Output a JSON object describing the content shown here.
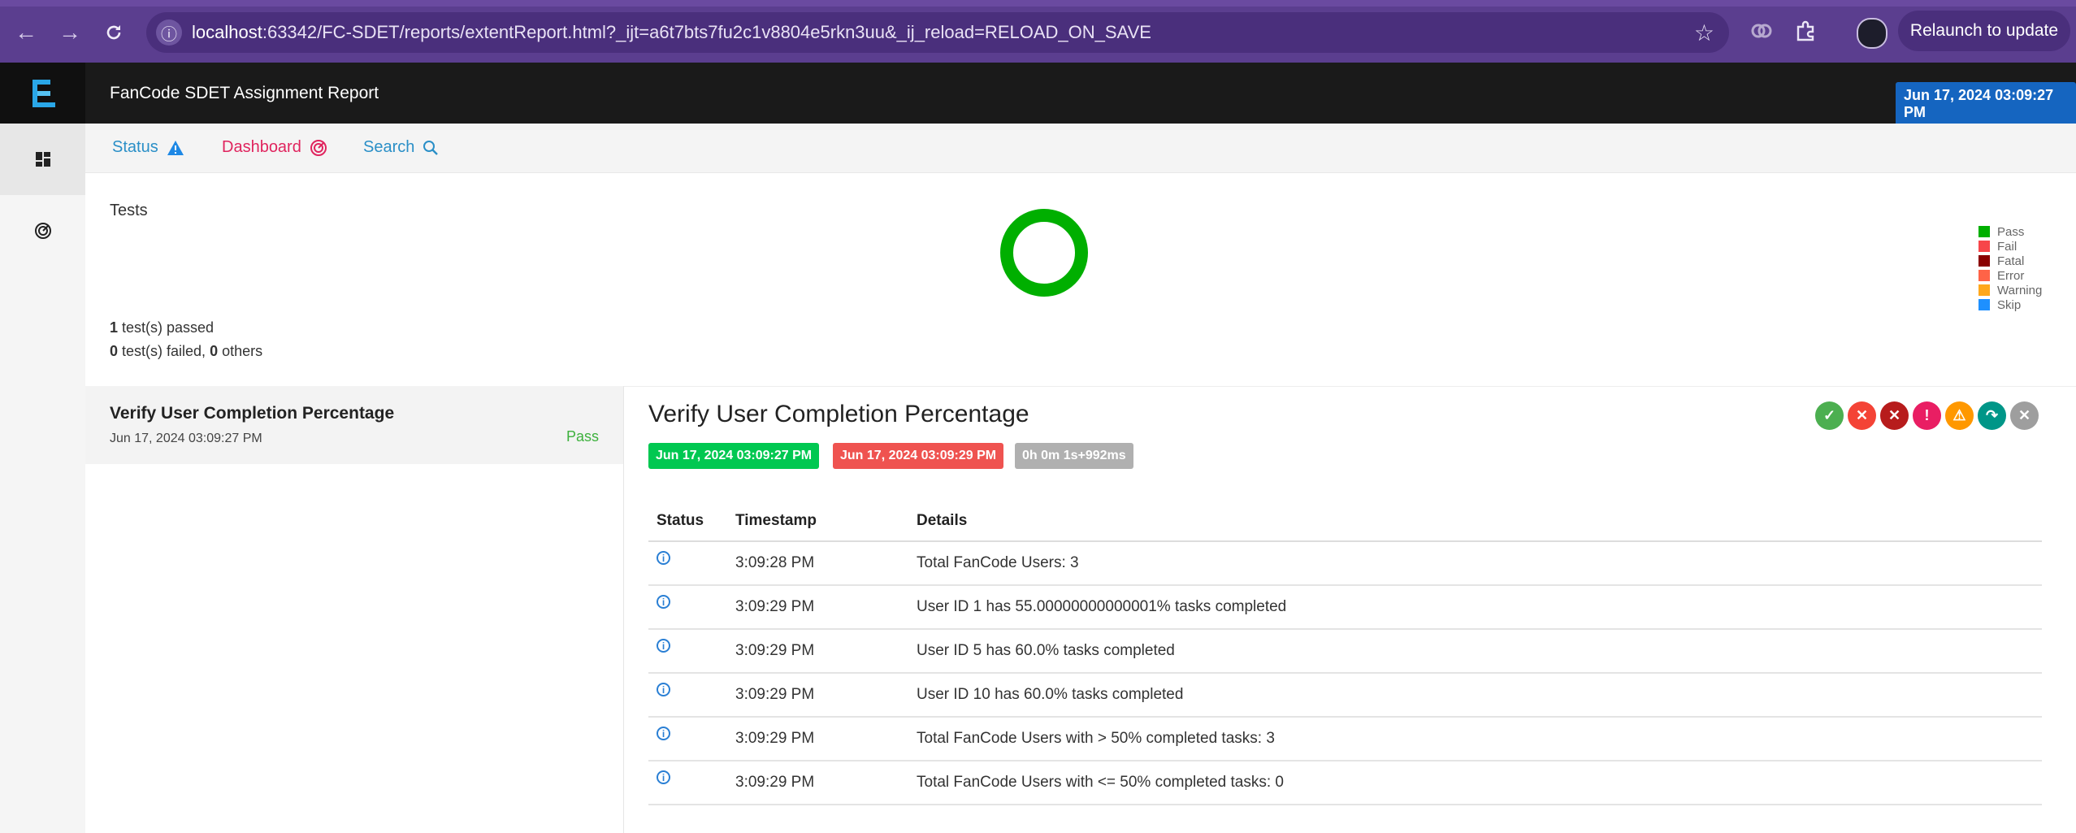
{
  "browser": {
    "url_host": "localhost",
    "url_rest": ":63342/FC-SDET/reports/extentReport.html?_ijt=a6t7bts7fu2c1v8804e5rkn3uu&_ij_reload=RELOAD_ON_SAVE",
    "relaunch_label": "Relaunch to update",
    "icons": [
      "back-icon",
      "forward-icon",
      "reload-icon",
      "site-info-icon",
      "star-icon",
      "extension-icon",
      "puzzle-icon",
      "profile-icon"
    ]
  },
  "header": {
    "title": "FanCode SDET Assignment Report",
    "datetime": "Jun 17, 2024 03:09:27 PM"
  },
  "subnav": {
    "status": "Status",
    "dashboard": "Dashboard",
    "search": "Search"
  },
  "summary": {
    "title": "Tests",
    "passed_count": "1",
    "passed_text": " test(s) passed",
    "failed_count": "0",
    "failed_text": " test(s) failed, ",
    "others_count": "0",
    "others_text": " others",
    "legend": [
      {
        "label": "Pass",
        "color": "#00af00"
      },
      {
        "label": "Fail",
        "color": "#f7464a"
      },
      {
        "label": "Fatal",
        "color": "#8b0000"
      },
      {
        "label": "Error",
        "color": "#ff6347"
      },
      {
        "label": "Warning",
        "color": "#ffa81c"
      },
      {
        "label": "Skip",
        "color": "#1e90ff"
      }
    ],
    "pass_fraction": 1.0
  },
  "test_list": [
    {
      "name": "Verify User Completion Percentage",
      "time": "Jun 17, 2024 03:09:27 PM",
      "status": "Pass"
    }
  ],
  "detail": {
    "title": "Verify User Completion Percentage",
    "start": "Jun 17, 2024 03:09:27 PM",
    "end": "Jun 17, 2024 03:09:29 PM",
    "duration": "0h 0m 1s+992ms",
    "columns": [
      "Status",
      "Timestamp",
      "Details"
    ],
    "logs": [
      {
        "time": "3:09:28 PM",
        "details": "Total FanCode Users: 3"
      },
      {
        "time": "3:09:29 PM",
        "details": "User ID 1 has 55.00000000000001% tasks completed"
      },
      {
        "time": "3:09:29 PM",
        "details": "User ID 5 has 60.0% tasks completed"
      },
      {
        "time": "3:09:29 PM",
        "details": "User ID 10 has 60.0% tasks completed"
      },
      {
        "time": "3:09:29 PM",
        "details": "Total FanCode Users with > 50% completed tasks: 3"
      },
      {
        "time": "3:09:29 PM",
        "details": "Total FanCode Users with <= 50% completed tasks: 0"
      }
    ],
    "status_filter_icons": [
      "pass-icon",
      "fail-icon",
      "fatal-icon",
      "error-icon",
      "warning-icon",
      "skip-icon",
      "clear-icon"
    ],
    "colors": {
      "start_badge": "#00c851",
      "end_badge": "#ef5350",
      "duration_badge": "#b0b0b0"
    }
  }
}
